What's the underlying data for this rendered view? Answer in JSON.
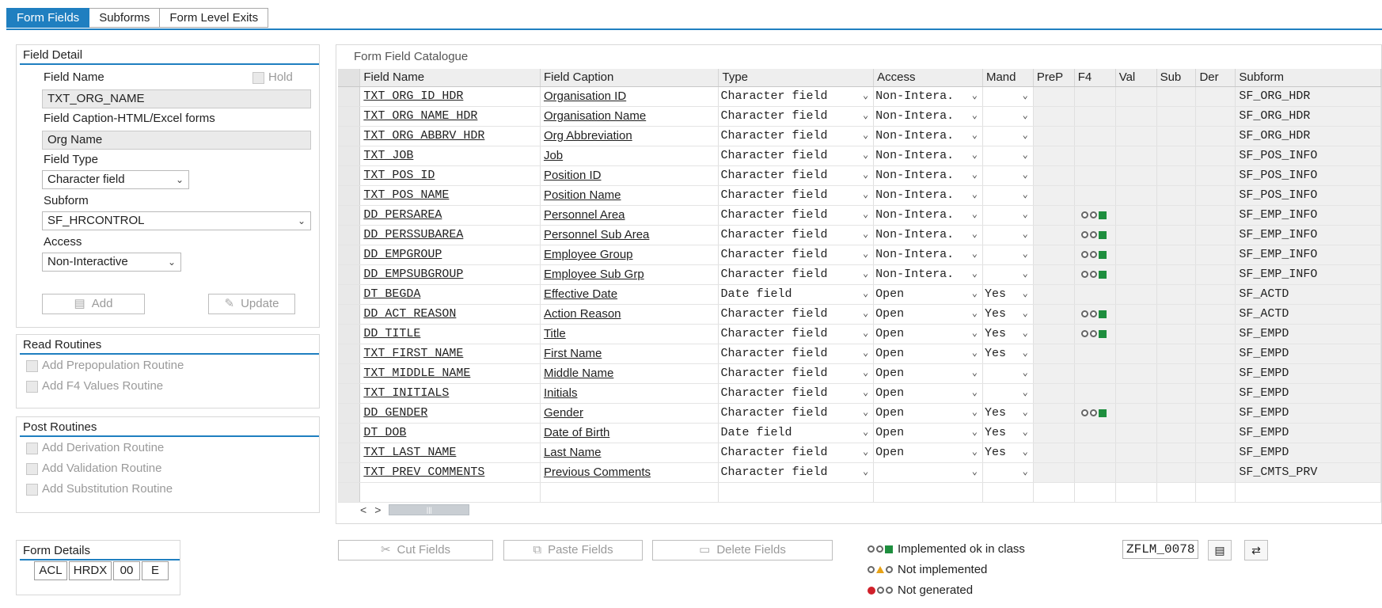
{
  "tabs": [
    {
      "label": "Form Fields",
      "active": true
    },
    {
      "label": "Subforms",
      "active": false
    },
    {
      "label": "Form Level Exits",
      "active": false
    }
  ],
  "field_detail": {
    "title": "Field Detail",
    "field_name_label": "Field Name",
    "hold_label": "Hold",
    "field_name_value": "TXT_ORG_NAME",
    "caption_label": "Field Caption-HTML/Excel forms",
    "caption_value": "Org Name",
    "type_label": "Field Type",
    "type_value": "Character field",
    "subform_label": "Subform",
    "subform_value": "SF_HRCONTROL",
    "access_label": "Access",
    "access_value": "Non-Interactive",
    "add_label": "Add",
    "update_label": "Update"
  },
  "read_routines": {
    "title": "Read Routines",
    "items": [
      "Add Prepopulation Routine",
      "Add F4 Values Routine"
    ]
  },
  "post_routines": {
    "title": "Post Routines",
    "items": [
      "Add Derivation Routine",
      "Add Validation Routine",
      "Add Substitution Routine"
    ]
  },
  "form_details": {
    "title": "Form Details",
    "cells": [
      "ACL",
      "HRDX",
      "00",
      "E"
    ]
  },
  "catalog": {
    "title": "Form Field Catalogue",
    "columns": [
      "Field Name",
      "Field Caption",
      "Type",
      "Access",
      "Mand",
      "PreP",
      "F4",
      "Val",
      "Sub",
      "Der",
      "Subform"
    ],
    "rows": [
      {
        "name": "TXT_ORG_ID_HDR",
        "caption": "Organisation ID",
        "type": "Character field",
        "access": "Non-Intera.",
        "mand": "",
        "f4": false,
        "subform": "SF_ORG_HDR"
      },
      {
        "name": "TXT_ORG_NAME_HDR",
        "caption": "Organisation Name",
        "type": "Character field",
        "access": "Non-Intera.",
        "mand": "",
        "f4": false,
        "subform": "SF_ORG_HDR"
      },
      {
        "name": "TXT_ORG_ABBRV_HDR",
        "caption": "Org Abbreviation",
        "type": "Character field",
        "access": "Non-Intera.",
        "mand": "",
        "f4": false,
        "subform": "SF_ORG_HDR"
      },
      {
        "name": "TXT_JOB",
        "caption": "Job",
        "type": "Character field",
        "access": "Non-Intera.",
        "mand": "",
        "f4": false,
        "subform": "SF_POS_INFO"
      },
      {
        "name": "TXT_POS_ID",
        "caption": "Position ID",
        "type": "Character field",
        "access": "Non-Intera.",
        "mand": "",
        "f4": false,
        "subform": "SF_POS_INFO"
      },
      {
        "name": "TXT_POS_NAME",
        "caption": "Position Name",
        "type": "Character field",
        "access": "Non-Intera.",
        "mand": "",
        "f4": false,
        "subform": "SF_POS_INFO"
      },
      {
        "name": "DD_PERSAREA",
        "caption": "Personnel Area",
        "type": "Character field",
        "access": "Non-Intera.",
        "mand": "",
        "f4": true,
        "subform": "SF_EMP_INFO"
      },
      {
        "name": "DD_PERSSUBAREA",
        "caption": "Personnel Sub Area",
        "type": "Character field",
        "access": "Non-Intera.",
        "mand": "",
        "f4": true,
        "subform": "SF_EMP_INFO"
      },
      {
        "name": "DD_EMPGROUP",
        "caption": "Employee Group",
        "type": "Character field",
        "access": "Non-Intera.",
        "mand": "",
        "f4": true,
        "subform": "SF_EMP_INFO"
      },
      {
        "name": "DD_EMPSUBGROUP",
        "caption": "Employee Sub Grp",
        "type": "Character field",
        "access": "Non-Intera.",
        "mand": "",
        "f4": true,
        "subform": "SF_EMP_INFO"
      },
      {
        "name": "DT_BEGDA",
        "caption": "Effective Date",
        "type": "Date field",
        "access": "Open",
        "mand": "Yes",
        "f4": false,
        "subform": "SF_ACTD"
      },
      {
        "name": "DD_ACT_REASON",
        "caption": "Action Reason",
        "type": "Character field",
        "access": "Open",
        "mand": "Yes",
        "f4": true,
        "subform": "SF_ACTD"
      },
      {
        "name": "DD_TITLE",
        "caption": "Title",
        "type": "Character field",
        "access": "Open",
        "mand": "Yes",
        "f4": true,
        "subform": "SF_EMPD"
      },
      {
        "name": "TXT_FIRST_NAME",
        "caption": "First Name",
        "type": "Character field",
        "access": "Open",
        "mand": "Yes",
        "f4": false,
        "subform": "SF_EMPD"
      },
      {
        "name": "TXT_MIDDLE_NAME",
        "caption": "Middle Name",
        "type": "Character field",
        "access": "Open",
        "mand": "",
        "f4": false,
        "subform": "SF_EMPD"
      },
      {
        "name": "TXT_INITIALS",
        "caption": "Initials",
        "type": "Character field",
        "access": "Open",
        "mand": "",
        "f4": false,
        "subform": "SF_EMPD"
      },
      {
        "name": "DD_GENDER",
        "caption": "Gender",
        "type": "Character field",
        "access": "Open",
        "mand": "Yes",
        "f4": true,
        "subform": "SF_EMPD"
      },
      {
        "name": "DT_DOB",
        "caption": "Date of Birth",
        "type": "Date field",
        "access": "Open",
        "mand": "Yes",
        "f4": false,
        "subform": "SF_EMPD"
      },
      {
        "name": "TXT_LAST_NAME",
        "caption": "Last Name",
        "type": "Character field",
        "access": "Open",
        "mand": "Yes",
        "f4": false,
        "subform": "SF_EMPD"
      },
      {
        "name": "TXT_PREV_COMMENTS",
        "caption": "Previous Comments",
        "type": "Character field",
        "access": "",
        "mand": "",
        "f4": false,
        "subform": "SF_CMTS_PRV"
      }
    ]
  },
  "actions": {
    "cut": "Cut Fields",
    "paste": "Paste Fields",
    "delete": "Delete Fields"
  },
  "legend": {
    "ok": "Implemented ok in class",
    "not_impl": "Not implemented",
    "not_gen": "Not generated"
  },
  "program": "ZFLM_0078",
  "colors": {
    "accent": "#1f7fc0",
    "ok_green": "#1e8e3e",
    "warn_amber": "#e8a317",
    "error_red": "#d0202a"
  }
}
